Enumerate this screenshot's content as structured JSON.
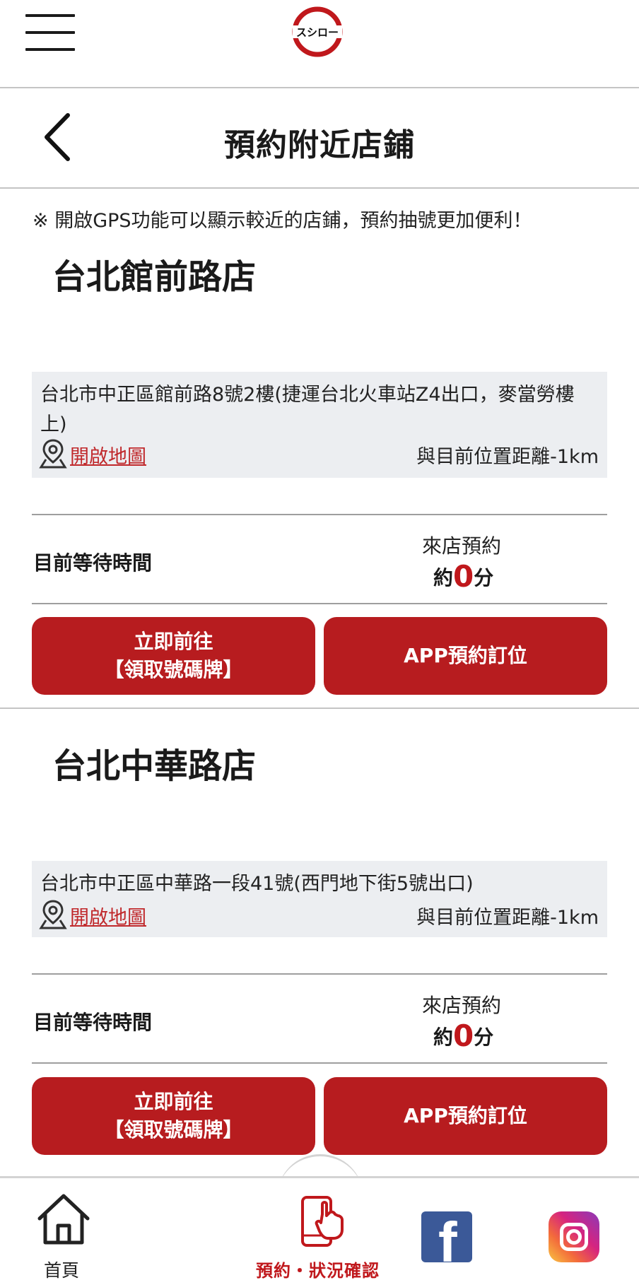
{
  "header": {
    "logo_text": "スシロー",
    "page_title": "預約附近店鋪"
  },
  "notice": "※ 開啟GPS功能可以顯示較近的店鋪，預約抽號更加便利！",
  "stores": [
    {
      "name": "台北館前路店",
      "address": "台北市中正區館前路8號2樓(捷運台北火車站Z4出口，麥當勞樓上)",
      "map_link": "開啟地圖",
      "distance": "與目前位置距離-1km",
      "wait_label": "目前等待時間",
      "visit_label": "來店預約",
      "wait_prefix": "約",
      "wait_minutes": "0",
      "wait_suffix": "分",
      "go_button_line1": "立即前往",
      "go_button_line2": "【領取號碼牌】",
      "app_button": "APP預約訂位"
    },
    {
      "name": "台北中華路店",
      "address": "台北市中正區中華路一段41號(西門地下街5號出口)",
      "map_link": "開啟地圖",
      "distance": "與目前位置距離-1km",
      "wait_label": "目前等待時間",
      "visit_label": "來店預約",
      "wait_prefix": "約",
      "wait_minutes": "0",
      "wait_suffix": "分",
      "go_button_line1": "立即前往",
      "go_button_line2": "【領取號碼牌】",
      "app_button": "APP預約訂位"
    }
  ],
  "bottom_nav": {
    "home_label": "首頁",
    "reserve_label": "預約・狀況確認",
    "facebook_icon": "facebook-icon",
    "instagram_icon": "instagram-icon"
  },
  "colors": {
    "accent": "#b71c1f",
    "link": "#c0282b",
    "address_bg": "#eceef1"
  }
}
